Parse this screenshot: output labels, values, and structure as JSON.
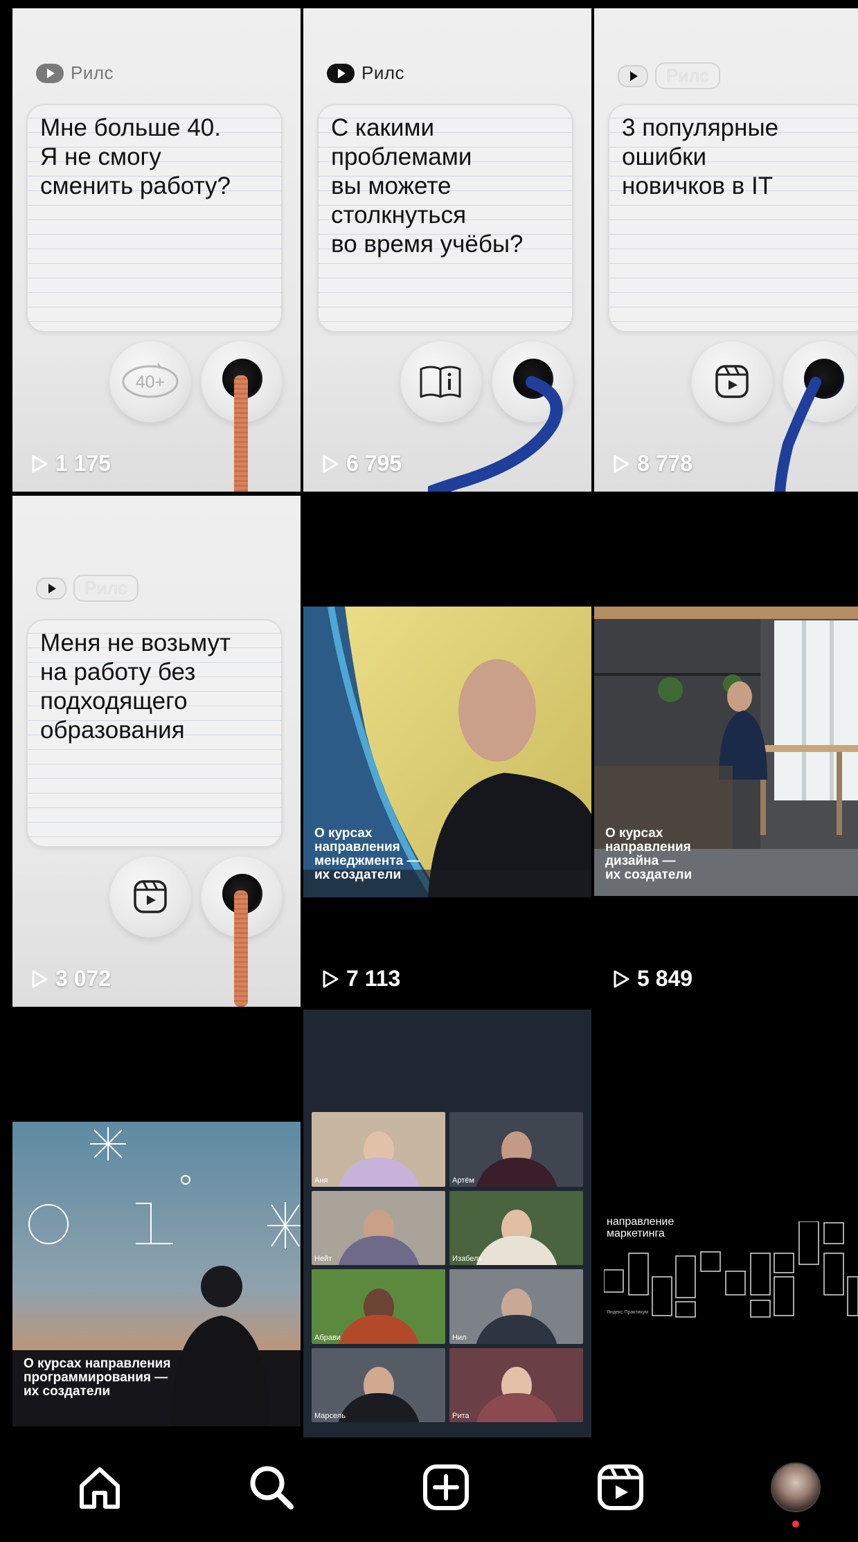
{
  "tiles": [
    {
      "tag": "Рилс",
      "text": "Мне больше 40.\nЯ не смогу\nсменить работу?",
      "views": "1 175"
    },
    {
      "tag": "Рилс",
      "text": "С какими\nпроблемами\nвы можете\nстолкнуться\nво время учёбы?",
      "views": "6 795"
    },
    {
      "tag": "Рилс",
      "text": "3 популярные\nошибки\nновичков в IT",
      "views": "8 778"
    },
    {
      "tag": "Рилс",
      "text": "Меня не возьмут\nна работу без\nподходящего\nобразования",
      "views": "3 072"
    },
    {
      "caption": "О курсах\nнаправления\nменеджмента —\nих создатели",
      "views": "7 113"
    },
    {
      "caption": "О курсах\nнаправления\nдизайна —\nих создатели",
      "views": "5 849"
    },
    {
      "caption": "О курсах направления\nпрограммирования —\nих создатели"
    },
    {
      "people": [
        "Аня",
        "Артём",
        "Нейт",
        "Изабель",
        "Абрави",
        "Нил",
        "Марсель",
        "Рита"
      ]
    },
    {
      "caption": "направление\nмаркетинга",
      "brand": "Яндекс Практикум"
    }
  ],
  "badges": {
    "age": "40+"
  },
  "icons": {
    "play": "play-icon",
    "home": "home-icon",
    "search": "search-icon",
    "create": "plus-square-icon",
    "reels": "reels-icon",
    "book": "book-info-icon",
    "age": "age-badge-icon"
  },
  "colors": {
    "background": "#000000",
    "card": "#ececec",
    "cable_orange": "#d8825a",
    "cable_blue": "#1f3f9a",
    "notification_dot": "#ff3040"
  }
}
